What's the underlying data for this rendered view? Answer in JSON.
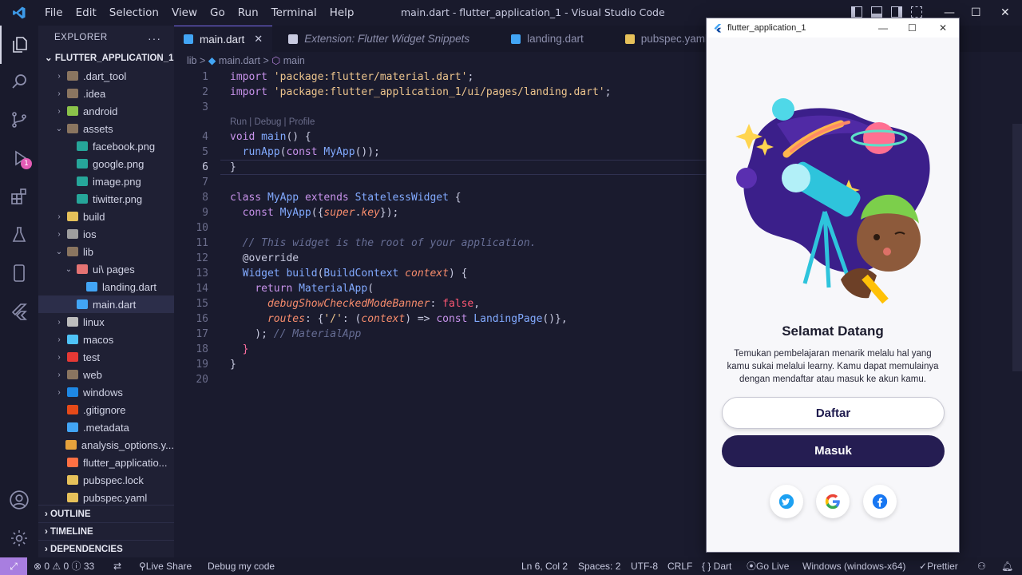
{
  "window": {
    "title": "main.dart - flutter_application_1 - Visual Studio Code",
    "menu": [
      "File",
      "Edit",
      "Selection",
      "View",
      "Go",
      "Run",
      "Terminal",
      "Help"
    ],
    "controls": {
      "minimize": "—",
      "maximize": "☐",
      "close": "✕"
    }
  },
  "activity_bar": {
    "items": [
      "explorer-icon",
      "search-icon",
      "source-control-icon",
      "run-debug-icon",
      "extensions-icon",
      "testing-icon",
      "device-icon",
      "flutter-icon"
    ],
    "debug_badge": "1",
    "bottom": [
      "account-icon",
      "settings-gear-icon"
    ]
  },
  "sidebar": {
    "header": "EXPLORER",
    "more": "···",
    "project": "FLUTTER_APPLICATION_1",
    "tree": [
      {
        "label": ".dart_tool",
        "indent": 1,
        "chev": "›",
        "color": "#8a7560"
      },
      {
        "label": ".idea",
        "indent": 1,
        "chev": "›",
        "color": "#8a7560"
      },
      {
        "label": "android",
        "indent": 1,
        "chev": "›",
        "color": "#8bc34a"
      },
      {
        "label": "assets",
        "indent": 1,
        "chev": "⌄",
        "color": "#8a7560"
      },
      {
        "label": "facebook.png",
        "indent": 2,
        "chev": "",
        "color": "#26a69a"
      },
      {
        "label": "google.png",
        "indent": 2,
        "chev": "",
        "color": "#26a69a"
      },
      {
        "label": "image.png",
        "indent": 2,
        "chev": "",
        "color": "#26a69a"
      },
      {
        "label": "tiwitter.png",
        "indent": 2,
        "chev": "",
        "color": "#26a69a"
      },
      {
        "label": "build",
        "indent": 1,
        "chev": "›",
        "color": "#e6c15a"
      },
      {
        "label": "ios",
        "indent": 1,
        "chev": "›",
        "color": "#9e9e9e"
      },
      {
        "label": "lib",
        "indent": 1,
        "chev": "⌄",
        "color": "#8a7560"
      },
      {
        "label": "ui\\ pages",
        "indent": 2,
        "chev": "⌄",
        "color": "#e57373"
      },
      {
        "label": "landing.dart",
        "indent": 3,
        "chev": "",
        "color": "#42a5f5"
      },
      {
        "label": "main.dart",
        "indent": 2,
        "chev": "",
        "color": "#42a5f5",
        "selected": true
      },
      {
        "label": "linux",
        "indent": 1,
        "chev": "›",
        "color": "#bdbdbd"
      },
      {
        "label": "macos",
        "indent": 1,
        "chev": "›",
        "color": "#4fc3f7"
      },
      {
        "label": "test",
        "indent": 1,
        "chev": "›",
        "color": "#e53935"
      },
      {
        "label": "web",
        "indent": 1,
        "chev": "›",
        "color": "#8a7560"
      },
      {
        "label": "windows",
        "indent": 1,
        "chev": "›",
        "color": "#1e88e5"
      },
      {
        "label": ".gitignore",
        "indent": 1,
        "chev": "",
        "color": "#e64a19"
      },
      {
        "label": ".metadata",
        "indent": 1,
        "chev": "",
        "color": "#42a5f5"
      },
      {
        "label": "analysis_options.y...",
        "indent": 1,
        "chev": "",
        "color": "#e6a23c"
      },
      {
        "label": "flutter_applicatio...",
        "indent": 1,
        "chev": "",
        "color": "#ff7043"
      },
      {
        "label": "pubspec.lock",
        "indent": 1,
        "chev": "",
        "color": "#e6c15a"
      },
      {
        "label": "pubspec.yaml",
        "indent": 1,
        "chev": "",
        "color": "#e6c15a"
      }
    ],
    "sections": [
      "OUTLINE",
      "TIMELINE",
      "DEPENDENCIES"
    ]
  },
  "tabs": [
    {
      "label": "main.dart",
      "active": true,
      "close": "✕",
      "color": "#42a5f5"
    },
    {
      "label": "Extension: Flutter Widget Snippets",
      "italic": true,
      "color": "#c8cae0"
    },
    {
      "label": "landing.dart",
      "color": "#42a5f5"
    },
    {
      "label": "pubspec.yaml",
      "color": "#e6c15a"
    }
  ],
  "breadcrumb": {
    "folder": "lib",
    "file": "main.dart",
    "symbol": "main",
    "sep": ">"
  },
  "code": {
    "codelens": "Run | Debug | Profile",
    "current_line": 6
  },
  "status": {
    "remote": "⤢",
    "problems": "⊗ 0 ⚠ 0 ⓘ 33",
    "live_share": "Live Share",
    "debug": "Debug my code",
    "position": "Ln 6, Col 2",
    "spaces": "Spaces: 2",
    "encoding": "UTF-8",
    "eol": "CRLF",
    "language": "{ } Dart",
    "go_live": "Go Live",
    "device": "Windows (windows-x64)",
    "prettier": "Prettier"
  },
  "app_window": {
    "title": "flutter_application_1",
    "heading": "Selamat Datang",
    "description": "Temukan pembelajaran menarik melalu hal yang kamu sukai melalui learny. Kamu dapat memulainya dengan mendaftar atau masuk ke akun kamu.",
    "register_label": "Daftar",
    "login_label": "Masuk",
    "social": [
      "twitter-icon",
      "google-icon",
      "facebook-icon"
    ],
    "colors": {
      "primary": "#251d52",
      "twitter": "#1da1f2",
      "facebook": "#1877f2"
    }
  }
}
